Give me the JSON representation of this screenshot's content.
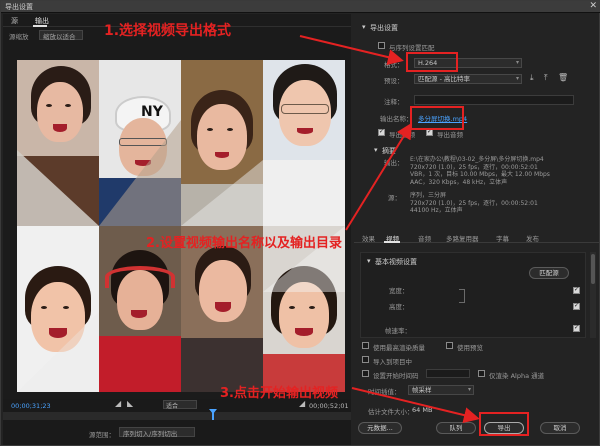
{
  "window": {
    "title": "导出设置",
    "close_glyph": "✕"
  },
  "left": {
    "tabs": [
      "源",
      "输出"
    ],
    "source_scaling_label": "源缩放",
    "source_scaling_value": "缩放以适合",
    "timecode_in": "00;00;31;23",
    "timecode_out": "00;00;52;01",
    "fit_value": "适合",
    "source_range_label": "源范围：",
    "source_range_value": "序列切入/序列切出"
  },
  "right": {
    "export_settings_header": "导出设置",
    "match_sequence_label": "与序列设置匹配",
    "format_label": "格式：",
    "format_value": "H.264",
    "preset_label": "预设：",
    "preset_value": "匹配源 - 高比特率",
    "comments_label": "注释：",
    "output_name_label": "输出名称：",
    "output_name_value": "多分屏切换.mp4",
    "export_video_label": "导出视频",
    "export_audio_label": "导出音频",
    "summary_header": "摘要",
    "summary_output_label": "输出：",
    "summary_output": "E:\\在家办公\\教程\\03-02_多分屏\\多分屏切换.mp4\n720x720 (1.0)，25 fps，逐行，00:00:52:01\nVBR，1 次，目标 10.00 Mbps，最大 12.00 Mbps\nAAC，320 Kbps，48 kHz，立体声",
    "summary_source_label": "源：",
    "summary_source": "序列，三分屏\n720x720 (1.0)，25 fps，逐行，00:00:52:01\n44100 Hz，立体声",
    "subtabs": [
      "效果",
      "视频",
      "音频",
      "多路复用器",
      "字幕",
      "发布"
    ],
    "basic_video_header": "基本视频设置",
    "match_source_button": "匹配源",
    "width_label": "宽度：",
    "height_label": "高度：",
    "frame_rate_label": "帧速率：",
    "max_render_quality_label": "使用最高渲染质量",
    "use_previews_label": "使用预览",
    "import_into_project_label": "导入到项目中",
    "set_start_timecode_label": "设置开始时间码",
    "render_alpha_only_label": "仅渲染 Alpha 通道",
    "time_interpolation_label": "时间插值：",
    "time_interpolation_value": "帧采样",
    "file_size_label": "估计文件大小：",
    "file_size_value": "64 MB",
    "metadata_button": "元数据...",
    "queue_button": "队列",
    "export_button": "导出",
    "cancel_button": "取消"
  },
  "annotations": {
    "step1": "1.选择视频导出格式",
    "step2": "2.设置视频输出名称以及输出目录",
    "step3": "3.点击开始输出视频"
  },
  "colors": {
    "annotation": "#e42222",
    "link": "#4aa3ff",
    "panel": "#232323"
  }
}
